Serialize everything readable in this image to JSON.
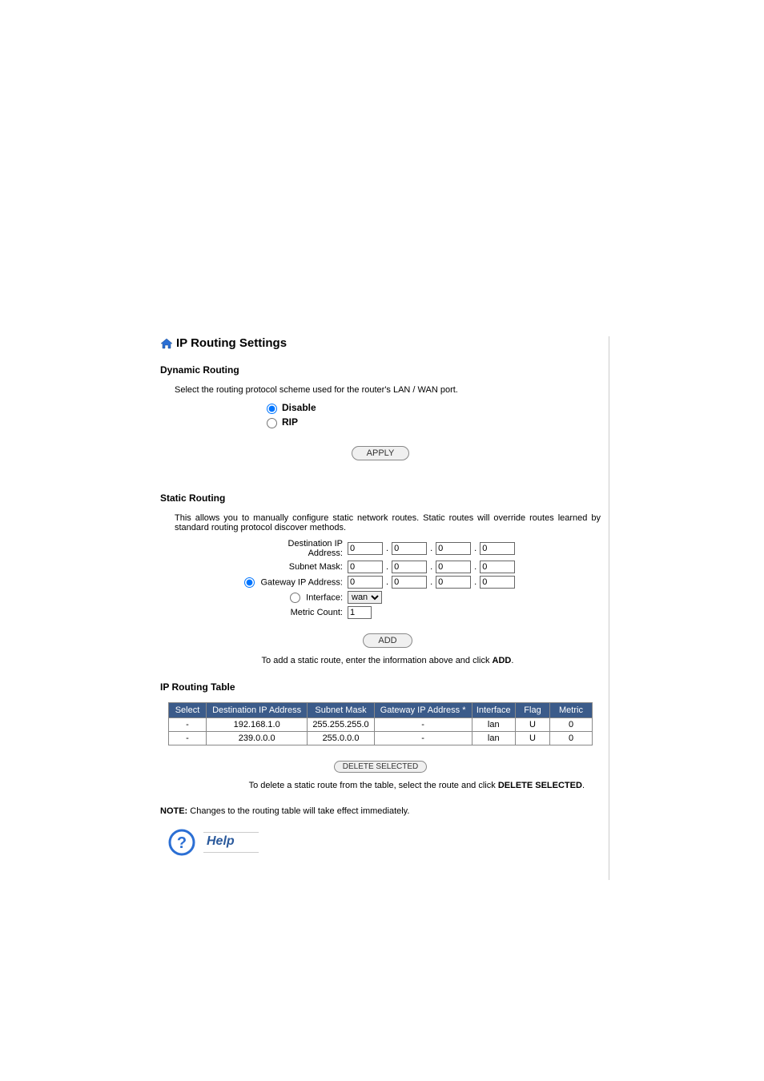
{
  "title": "IP Routing Settings",
  "dynamic": {
    "heading": "Dynamic Routing",
    "desc": "Select the routing protocol scheme used for the router's LAN / WAN port.",
    "opt_disable": "Disable",
    "opt_rip": "RIP",
    "apply_label": "APPLY"
  },
  "static": {
    "heading": "Static Routing",
    "desc": "This allows you to manually configure static network routes. Static routes will override routes learned by standard routing protocol discover methods.",
    "dest_label": "Destination IP Address:",
    "subnet_label": "Subnet Mask:",
    "gateway_label": "Gateway IP Address:",
    "iface_label": "Interface:",
    "metric_label": "Metric Count:",
    "dest": [
      "0",
      "0",
      "0",
      "0"
    ],
    "subnet": [
      "0",
      "0",
      "0",
      "0"
    ],
    "gateway": [
      "0",
      "0",
      "0",
      "0"
    ],
    "iface_selected": "wan",
    "metric": "1",
    "add_label": "ADD",
    "add_instr_pre": "To add a static route, enter the information above and click ",
    "add_instr_bold": "ADD"
  },
  "table": {
    "heading": "IP Routing Table",
    "cols": {
      "select": "Select",
      "dest": "Destination IP Address",
      "subnet": "Subnet Mask",
      "gateway": "Gateway IP Address *",
      "iface": "Interface",
      "flag": "Flag",
      "metric": "Metric"
    },
    "rows": [
      {
        "select": "-",
        "dest": "192.168.1.0",
        "subnet": "255.255.255.0",
        "gateway": "-",
        "iface": "lan",
        "flag": "U",
        "metric": "0"
      },
      {
        "select": "-",
        "dest": "239.0.0.0",
        "subnet": "255.0.0.0",
        "gateway": "-",
        "iface": "lan",
        "flag": "U",
        "metric": "0"
      }
    ],
    "delete_label": "DELETE SELECTED",
    "delete_instr_pre": "To delete a static route from the table, select the route and click ",
    "delete_instr_bold": "DELETE SELECTED"
  },
  "note_bold": "NOTE:",
  "note_text": " Changes to the routing table will take effect immediately.",
  "help": "Help"
}
